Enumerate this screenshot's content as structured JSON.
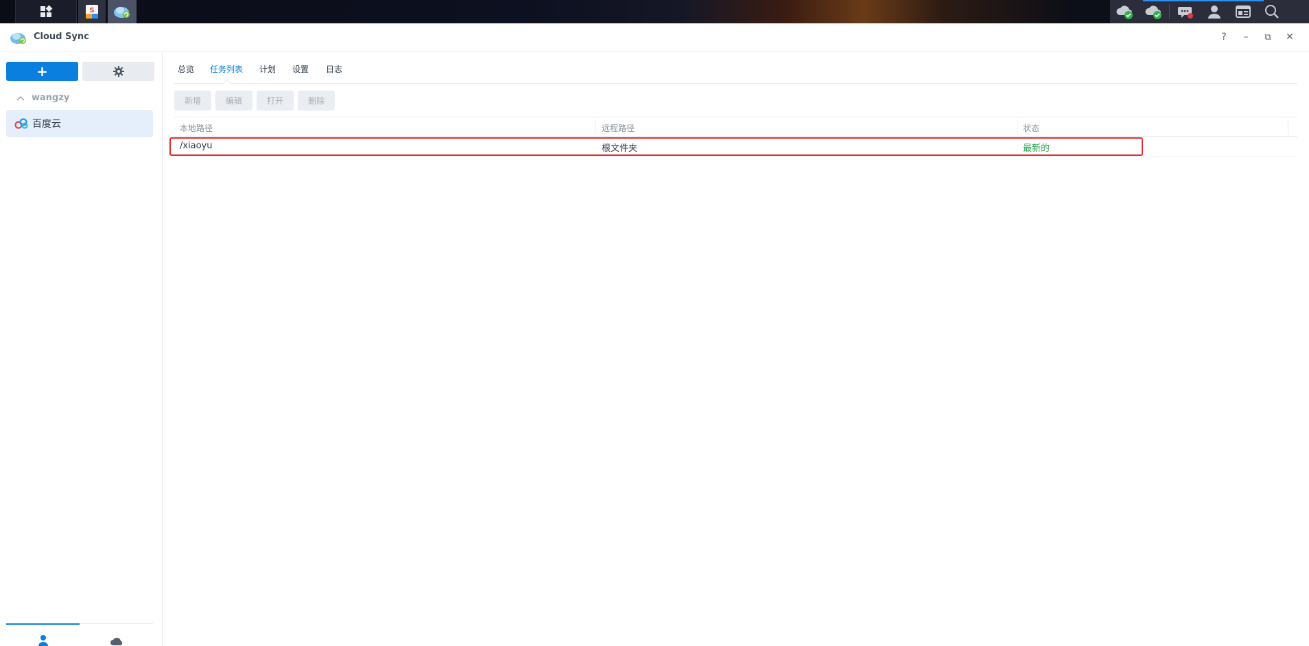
{
  "taskbar": {
    "apps_button_icon": "grid-icon",
    "apps": [
      {
        "name": "Synology Office",
        "icon": "office-app-icon"
      },
      {
        "name": "Cloud Sync",
        "icon": "cloud-sync-app-icon"
      }
    ],
    "tray": [
      "cloud-check-icon",
      "cloud-check-icon",
      "notifications-icon",
      "user-icon",
      "widgets-icon",
      "search-icon"
    ]
  },
  "window": {
    "title": "Cloud Sync",
    "controls": {
      "help": "?",
      "minimize": "–",
      "restore": "⧉",
      "close": "✕"
    }
  },
  "sidebar": {
    "add_button": "+",
    "settings_icon": "gear-icon",
    "group_label": "wangzy",
    "accounts": [
      {
        "label": "百度云",
        "icon": "baidu-cloud-icon"
      }
    ],
    "bottom_tabs": [
      {
        "icon": "user-icon",
        "active": true
      },
      {
        "icon": "cloud-icon",
        "active": false
      }
    ]
  },
  "tabs": [
    {
      "label": "总览",
      "active": false
    },
    {
      "label": "任务列表",
      "active": true
    },
    {
      "label": "计划",
      "active": false
    },
    {
      "label": "设置",
      "active": false
    },
    {
      "label": "日志",
      "active": false
    }
  ],
  "toolbar": {
    "new": "新增",
    "edit": "编辑",
    "open": "打开",
    "delete": "删除"
  },
  "table": {
    "columns": [
      "本地路径",
      "远程路径",
      "状态"
    ],
    "rows": [
      {
        "local": "/xiaoyu",
        "remote": "根文件夹",
        "status": "最新的"
      }
    ]
  },
  "colors": {
    "accent": "#0a7fe0",
    "status_ok": "#1fa34a",
    "highlight": "#e52b2b"
  }
}
